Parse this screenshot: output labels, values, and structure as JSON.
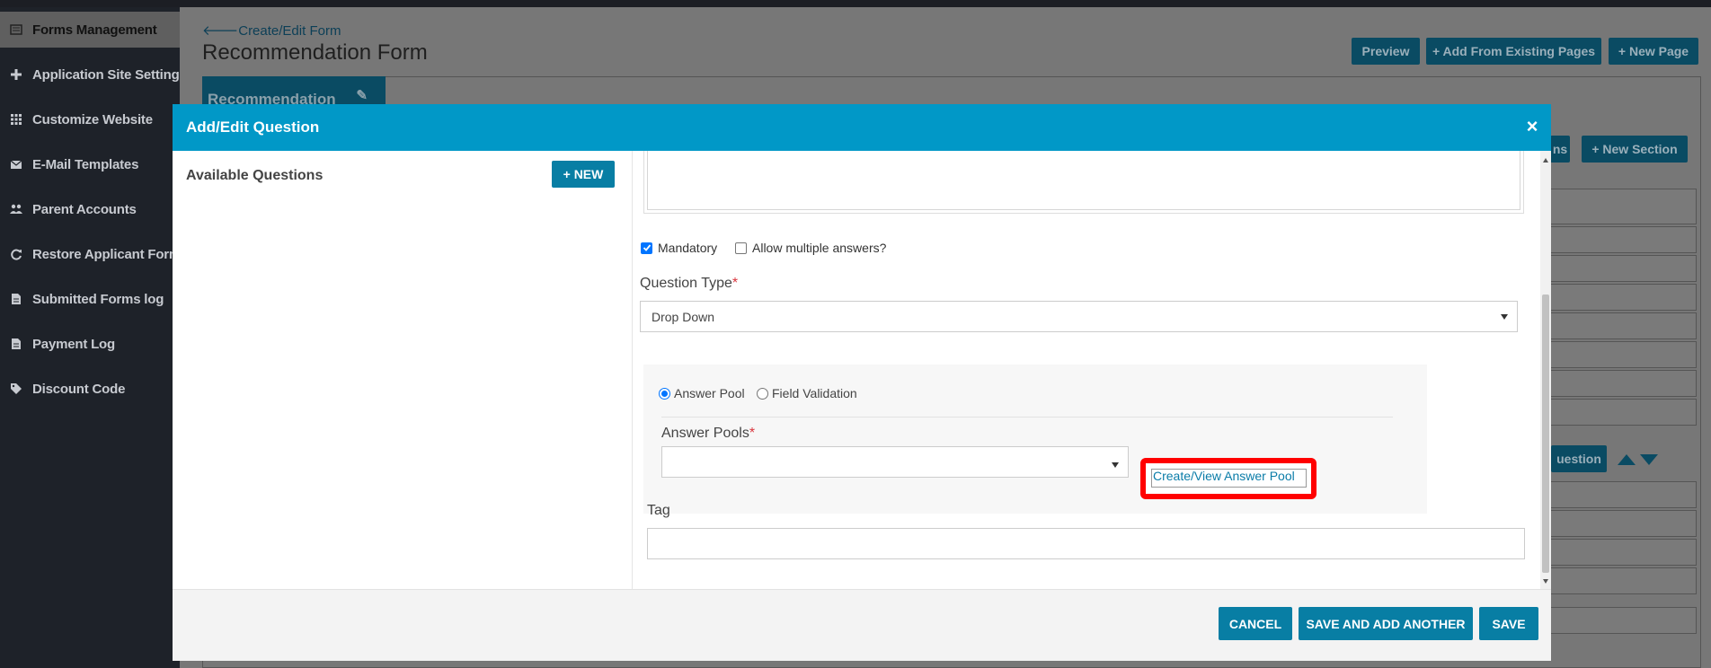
{
  "sidebar": {
    "items": [
      {
        "label": "Forms Management",
        "icon": "list-icon",
        "active": true
      },
      {
        "label": "Application Site Settings",
        "icon": "plus-icon"
      },
      {
        "label": "Customize Website",
        "icon": "grid-icon"
      },
      {
        "label": "E-Mail Templates",
        "icon": "envelope-icon"
      },
      {
        "label": "Parent Accounts",
        "icon": "users-icon"
      },
      {
        "label": "Restore Applicant Forms",
        "icon": "refresh-icon"
      },
      {
        "label": "Submitted Forms log",
        "icon": "file-icon"
      },
      {
        "label": "Payment Log",
        "icon": "file-icon"
      },
      {
        "label": "Discount Code",
        "icon": "tag-icon"
      }
    ]
  },
  "page": {
    "breadcrumb": "Create/Edit Form",
    "title": "Recommendation Form",
    "buttons": {
      "preview": "Preview",
      "add_existing": "+ Add From Existing Pages",
      "new_page": "+ New Page",
      "sections_partial": "ns",
      "new_section": "+ New Section",
      "question_partial": "uestion"
    },
    "tab_label": "Recommendation"
  },
  "modal": {
    "title": "Add/Edit Question",
    "close": "×",
    "available_questions": "Available Questions",
    "new_button": "+ NEW",
    "mandatory_label": "Mandatory",
    "mandatory_checked": true,
    "allow_multiple_label": "Allow multiple answers?",
    "allow_multiple_checked": false,
    "question_type_label": "Question Type",
    "required_mark": "*",
    "question_type_value": "Drop Down",
    "radio_answer_pool": "Answer Pool",
    "radio_field_validation": "Field Validation",
    "answer_pools_label": "Answer Pools",
    "answer_pools_value": "",
    "create_view_link": "Create/View Answer Pool",
    "tag_label": "Tag",
    "tag_value": "",
    "footer": {
      "cancel": "CANCEL",
      "save_add_another": "SAVE AND ADD ANOTHER",
      "save": "SAVE"
    }
  },
  "colors": {
    "modal_header": "#0198c7",
    "primary_button": "#087ea4",
    "highlight_box": "#ff0000",
    "sidebar_bg": "#1e2229"
  }
}
